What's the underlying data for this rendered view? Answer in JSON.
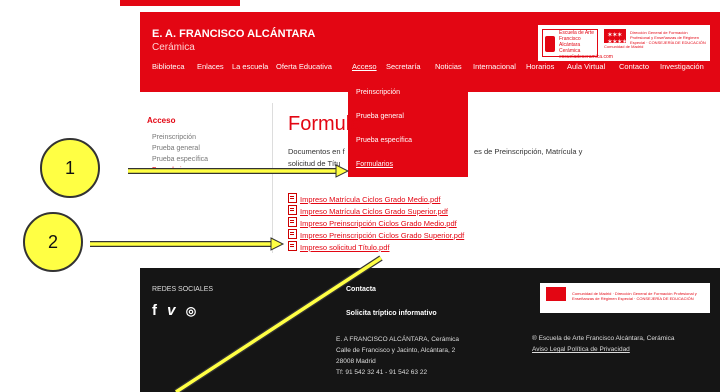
{
  "header": {
    "site_name": "E. A. FRANCISCO ALCÁNTARA",
    "site_subtitle": "Cerámica",
    "logo_escuela": [
      "Escuela de Arte",
      "Francisco Alcántara",
      "Cerámica",
      "escueladeceramica.com"
    ],
    "logo_cm_text": "Comunidad de Madrid",
    "logo_dg": "Dirección General de Formación Profesional y Enseñanzas de Régimen Especial · CONSEJERÍA DE EDUCACIÓN",
    "brand_color": "#e30613"
  },
  "nav": {
    "items": [
      "Biblioteca",
      "Enlaces",
      "La escuela",
      "Oferta Educativa",
      "Acceso",
      "Secretaría",
      "Noticias",
      "Internacional",
      "Horarios",
      "Aula Virtual",
      "Contacto",
      "Investigación"
    ],
    "active": "Acceso"
  },
  "dropdown": {
    "items": [
      "Preinscripción",
      "Prueba general",
      "Prueba específica",
      "Formularios"
    ]
  },
  "sidebar": {
    "title": "Acceso",
    "items": [
      "Preinscripción",
      "Prueba general",
      "Prueba específica",
      "Formularios"
    ]
  },
  "main": {
    "title": "Formula",
    "intro_line1": "Documentos en f",
    "intro_line1b": "es de Preinscripción, Matrícula y",
    "intro_line2": "solicitud de Títu",
    "files": [
      "Impreso Matrícula Ciclos Grado Medio.pdf",
      "Impreso Matrícula Ciclos Grado Superior.pdf",
      "Impreso Preinscripción Ciclos Grado Medio.pdf",
      "Impreso Preinscripción Ciclos Grado Superior.pdf",
      "Impreso solicitud Título.pdf"
    ]
  },
  "footer": {
    "social_title": "REDES SOCIALES",
    "social_icons": [
      "facebook-icon",
      "vimeo-icon",
      "instagram-icon"
    ],
    "contact_title": "Contacta",
    "triptico": "Solicita tríptico informativo",
    "address": [
      "E. A FRANCISCO ALCÁNTARA, Cerámica",
      "Calle de Francisco y Jacinto, Alcántara, 2",
      "28008 Madrid",
      "Tf: 91 542 32 41 - 91 542 63 22"
    ],
    "logo_text": "Comunidad de Madrid · Dirección General de Formación Profesional y Enseñanzas de Régimen Especial · CONSEJERÍA DE EDUCACIÓN",
    "copyright": "® Escuela de Arte Francisco Alcántara, Cerámica",
    "legal": "Aviso Legal Política de Privacidad"
  },
  "annotations": {
    "callout_1": "1",
    "callout_2": "2",
    "callout_color": "#ffff44"
  }
}
